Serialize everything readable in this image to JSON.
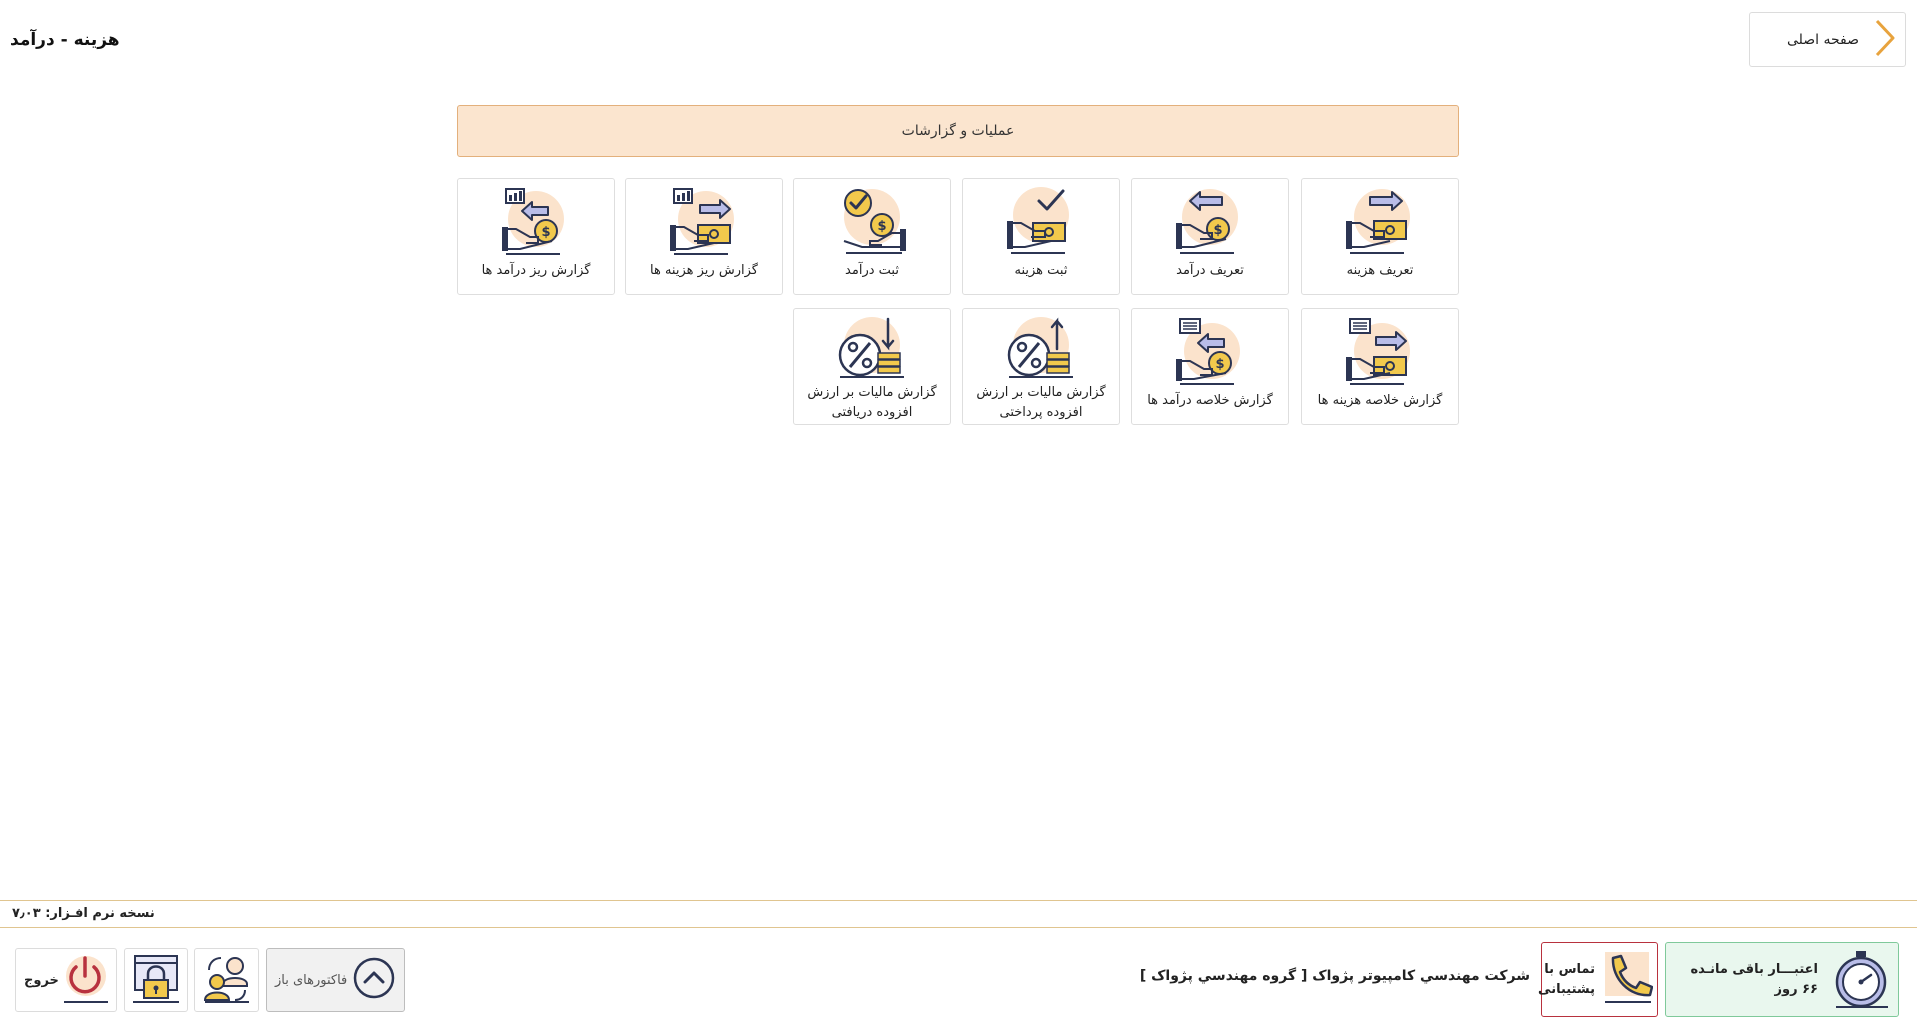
{
  "page_title": "هزینه - درآمد",
  "home_button": {
    "label": "صفحه اصلی",
    "icon": "chevron-right-icon"
  },
  "section_header": "عملیات و گزارشات",
  "tiles": [
    {
      "label": "تعریف هزینه",
      "icon": "define-expense-icon"
    },
    {
      "label": "تعریف درآمد",
      "icon": "define-income-icon"
    },
    {
      "label": "ثبت هزینه",
      "icon": "register-expense-icon"
    },
    {
      "label": "ثبت درآمد",
      "icon": "register-income-icon"
    },
    {
      "label": "گزارش ریز هزینه ها",
      "icon": "expense-detail-report-icon"
    },
    {
      "label": "گزارش ریز درآمد ها",
      "icon": "income-detail-report-icon"
    },
    {
      "label": "گزارش خلاصه هزینه ها",
      "icon": "expense-summary-report-icon"
    },
    {
      "label": "گزارش خلاصه درآمد ها",
      "icon": "income-summary-report-icon"
    },
    {
      "label": "گزارش مالیات بر ارزش افزوده پرداختی",
      "icon": "vat-paid-report-icon"
    },
    {
      "label": "گزارش مالیات بر ارزش افزوده دریافتی",
      "icon": "vat-received-report-icon"
    }
  ],
  "footer": {
    "version_label": "نسخه نرم افـزار: ۷٫۰۳",
    "credit": {
      "line1": "اعتبـــار باقی مانـده",
      "line2": "۶۶ روز"
    },
    "support": {
      "line1": "تماس با",
      "line2": "پشتیبانی"
    },
    "company": "شرکت مهندسي کامپيوتر پژواک [ گروه مهندسي پژواک ]",
    "open_invoices_label": "فاکتورهای باز",
    "exit_label": "خروج"
  },
  "colors": {
    "accent_orange": "#e8a33d",
    "icon_navy": "#2c3553",
    "icon_peach": "#fbe3cc",
    "icon_yellow": "#f2c94c",
    "icon_lavender": "#b9bde8",
    "credit_green": "#e9f7ee",
    "support_red": "#b8323e"
  }
}
